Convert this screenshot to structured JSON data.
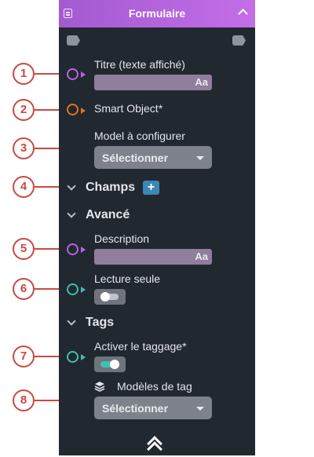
{
  "panel": {
    "title": "Formulaire",
    "header_icon": "form-icon",
    "collapse_icon": "chevron-up-icon",
    "accent_color": "#b565df"
  },
  "fields": {
    "titre_label": "Titre (texte affiché)",
    "titre_input_icon": "Aa",
    "smart_object_label": "Smart Object*",
    "model_label": "Model à configurer",
    "model_select": "Sélectionner",
    "description_label": "Description",
    "description_input_icon": "Aa",
    "lecture_seule_label": "Lecture seule",
    "lecture_seule_on": false,
    "activer_taggage_label": "Activer le taggage*",
    "activer_taggage_on": true,
    "modeles_tag_label": "Modèles de tag",
    "modeles_tag_select": "Sélectionner"
  },
  "sections": {
    "champs": "Champs",
    "champs_add": "+",
    "avance": "Avancé",
    "tags": "Tags"
  },
  "callouts": [
    "1",
    "2",
    "3",
    "4",
    "5",
    "6",
    "7",
    "8"
  ]
}
